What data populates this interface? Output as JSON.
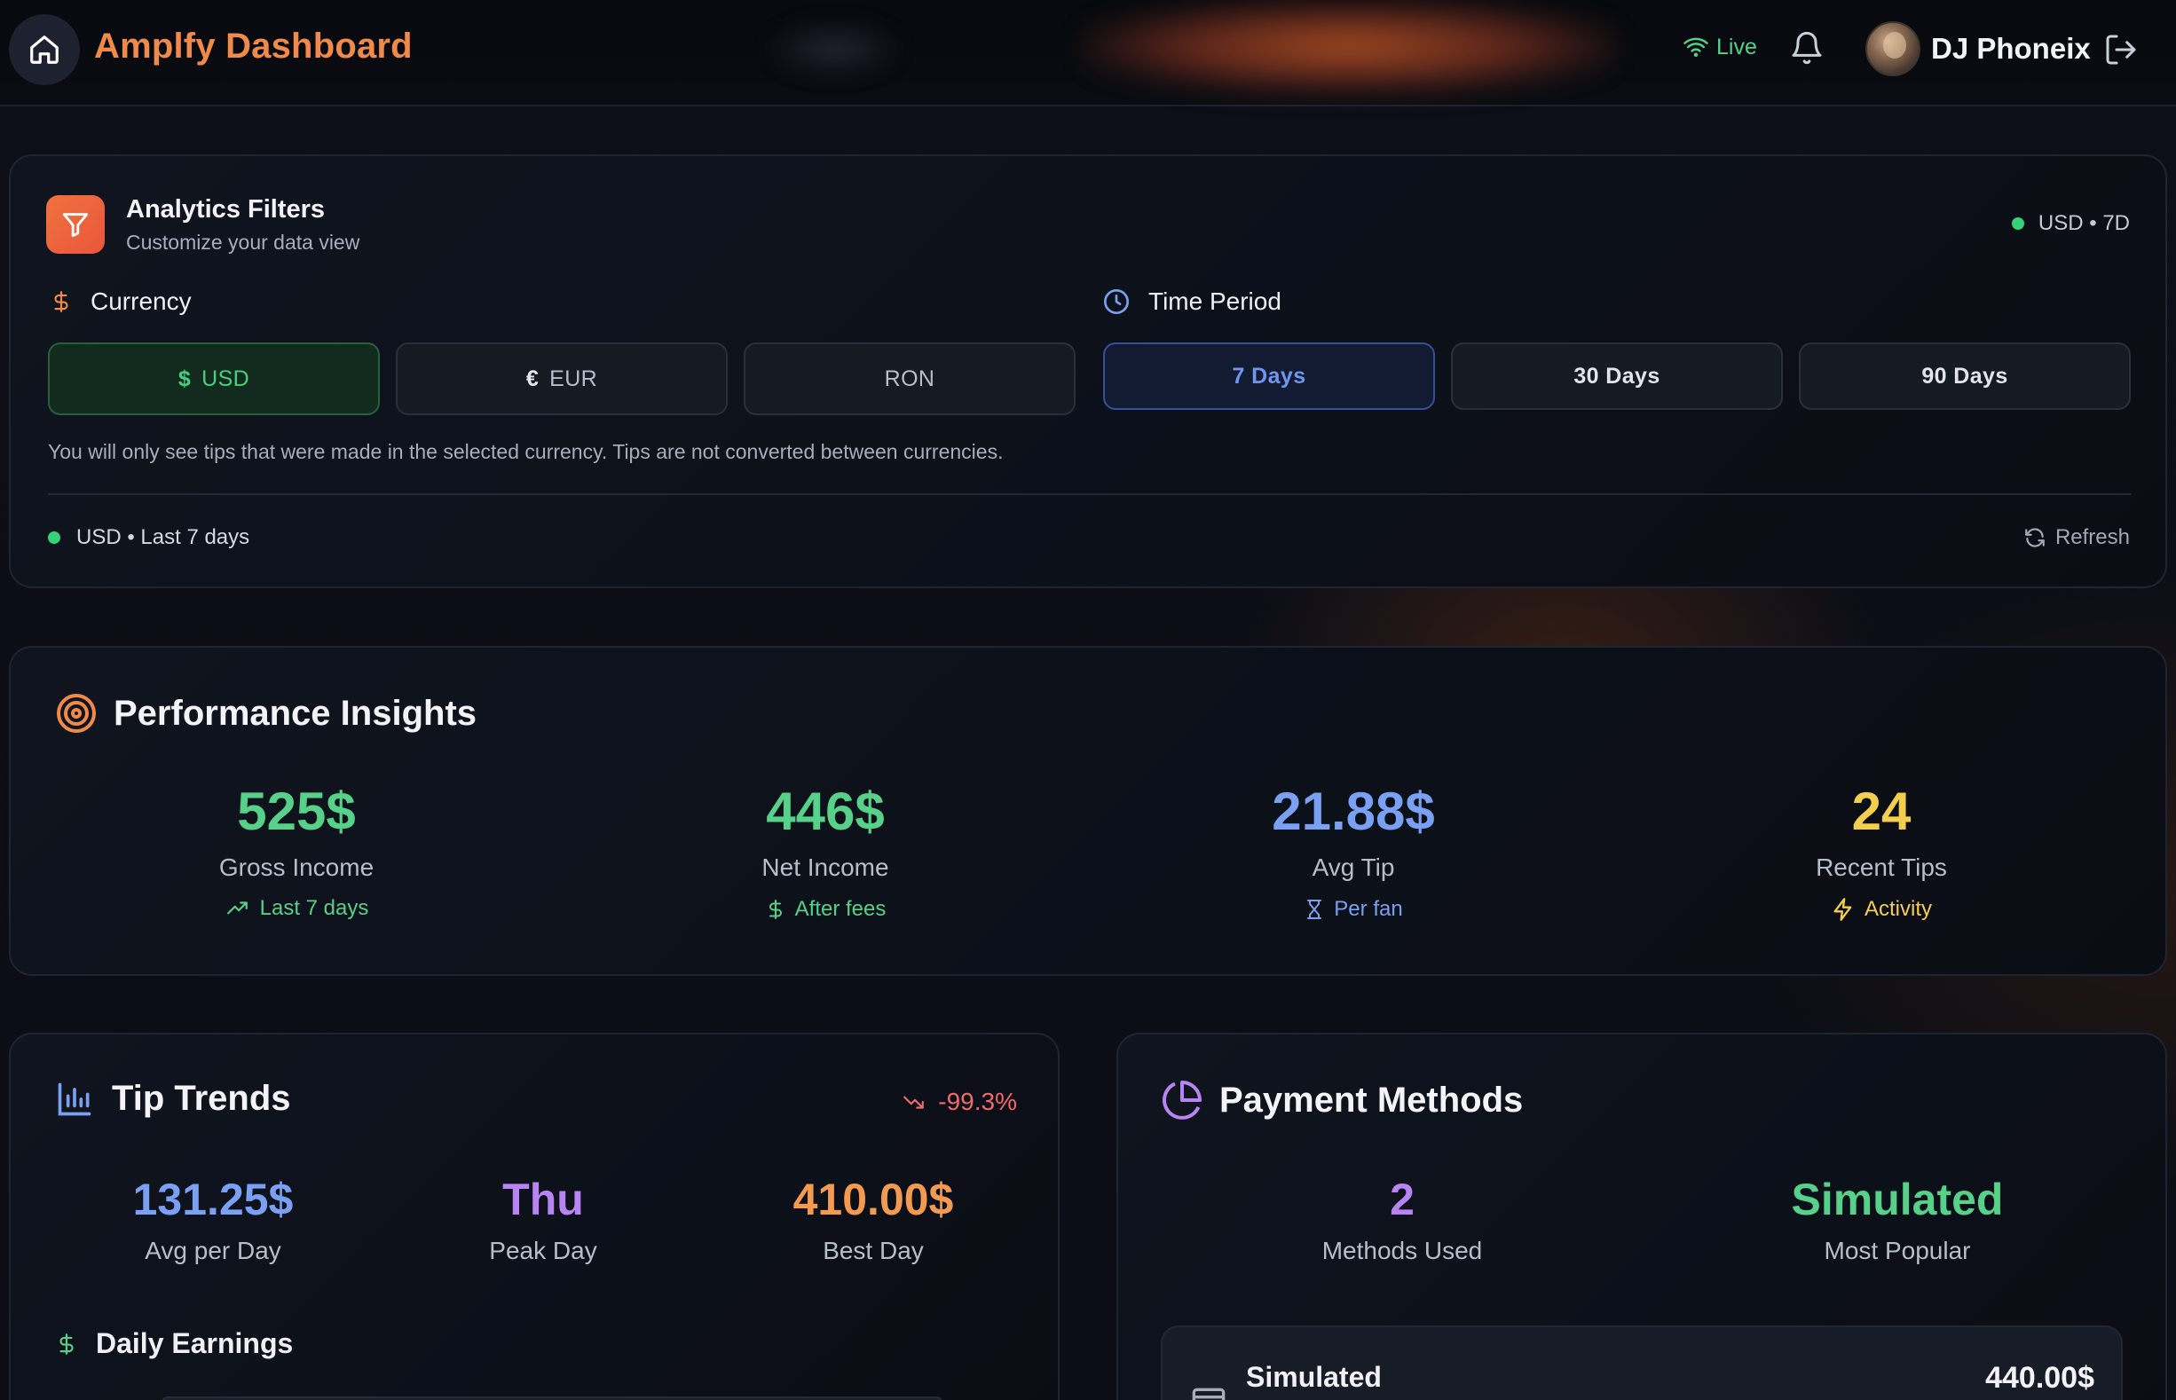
{
  "header": {
    "title": "Amplfy Dashboard",
    "live_label": "Live",
    "username": "DJ Phoneix"
  },
  "filters": {
    "title": "Analytics Filters",
    "subtitle": "Customize your data view",
    "status_chip": "USD • 7D",
    "currency_label": "Currency",
    "time_label": "Time Period",
    "currency_options": [
      {
        "symbol": "$",
        "label": "USD",
        "selected": true
      },
      {
        "symbol": "€",
        "label": "EUR",
        "selected": false
      },
      {
        "symbol": "",
        "label": "RON",
        "selected": false
      }
    ],
    "time_options": [
      {
        "label": "7 Days",
        "selected": true
      },
      {
        "label": "30 Days",
        "selected": false
      },
      {
        "label": "90 Days",
        "selected": false
      }
    ],
    "note": "You will only see tips that were made in the selected currency. Tips are not converted between currencies.",
    "footer_status": "USD • Last 7 days",
    "refresh_label": "Refresh"
  },
  "performance": {
    "title": "Performance Insights",
    "metrics": [
      {
        "value": "525$",
        "label": "Gross Income",
        "sub": "Last 7 days",
        "icon": "trending-up-icon"
      },
      {
        "value": "446$",
        "label": "Net Income",
        "sub": "After fees",
        "icon": "dollar-icon"
      },
      {
        "value": "21.88$",
        "label": "Avg Tip",
        "sub": "Per fan",
        "icon": "hourglass-icon"
      },
      {
        "value": "24",
        "label": "Recent Tips",
        "sub": "Activity",
        "icon": "lightning-icon"
      }
    ]
  },
  "trends": {
    "title": "Tip Trends",
    "change": "-99.3%",
    "stats": [
      {
        "value": "131.25$",
        "label": "Avg per Day"
      },
      {
        "value": "Thu",
        "label": "Peak Day"
      },
      {
        "value": "410.00$",
        "label": "Best Day"
      }
    ],
    "daily_title": "Daily Earnings"
  },
  "payments": {
    "title": "Payment Methods",
    "stats": [
      {
        "value": "2",
        "label": "Methods Used"
      },
      {
        "value": "Simulated",
        "label": "Most Popular"
      }
    ],
    "methods": [
      {
        "name": "Simulated",
        "amount": "440.00$"
      }
    ]
  },
  "colors": {
    "accent_orange": "#f08a4b",
    "green": "#57d08a",
    "blue": "#79a0f2",
    "yellow": "#f3cf4d",
    "purple": "#b884f3",
    "red": "#f06a6a"
  }
}
